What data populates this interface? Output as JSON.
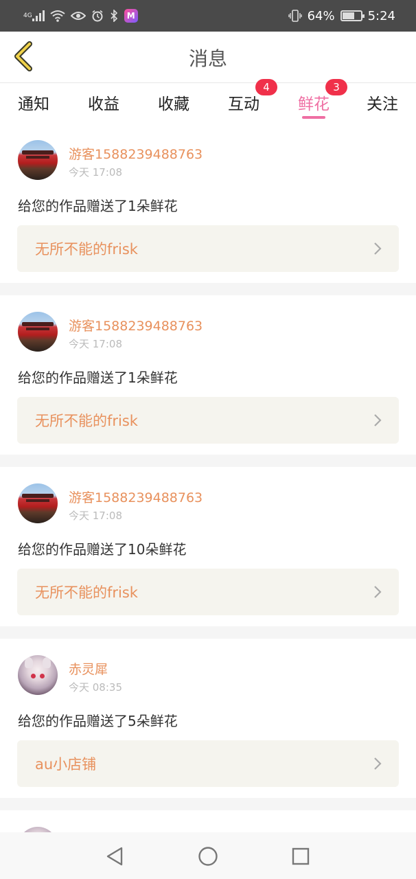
{
  "status_bar": {
    "signal_label": "4G",
    "battery_percent": "64%",
    "battery_level": 0.64,
    "time": "5:24",
    "app_icon_letter": "M",
    "icons": [
      "signal-icon",
      "wifi-icon",
      "eye-icon",
      "alarm-icon",
      "bluetooth-icon",
      "app-icon",
      "vibrate-icon",
      "battery-icon"
    ]
  },
  "header": {
    "title": "消息",
    "back_icon": "back-chevron-icon"
  },
  "tabs": [
    {
      "label": "通知",
      "badge": "",
      "active": false
    },
    {
      "label": "收益",
      "badge": "",
      "active": false
    },
    {
      "label": "收藏",
      "badge": "",
      "active": false
    },
    {
      "label": "互动",
      "badge": "4",
      "active": false
    },
    {
      "label": "鲜花",
      "badge": "3",
      "active": true
    },
    {
      "label": "关注",
      "badge": "",
      "active": false
    }
  ],
  "messages": [
    {
      "user": "游客1588239488763",
      "time": "今天 17:08",
      "text": "给您的作品赠送了1朵鲜花",
      "work": "无所不能的frisk",
      "avatar": "gate"
    },
    {
      "user": "游客1588239488763",
      "time": "今天 17:08",
      "text": "给您的作品赠送了1朵鲜花",
      "work": "无所不能的frisk",
      "avatar": "gate"
    },
    {
      "user": "游客1588239488763",
      "time": "今天 17:08",
      "text": "给您的作品赠送了10朵鲜花",
      "work": "无所不能的frisk",
      "avatar": "gate"
    },
    {
      "user": "赤灵犀",
      "time": "今天 08:35",
      "text": "给您的作品赠送了5朵鲜花",
      "work": "au小店铺",
      "avatar": "anime"
    }
  ],
  "colors": {
    "accent_pink": "#ef6fa3",
    "name_orange": "#e8915d",
    "badge_red": "#f0304a",
    "back_yellow": "#f0d24a"
  },
  "navbar": {
    "icons": [
      "nav-back-icon",
      "nav-home-icon",
      "nav-recent-icon"
    ]
  }
}
